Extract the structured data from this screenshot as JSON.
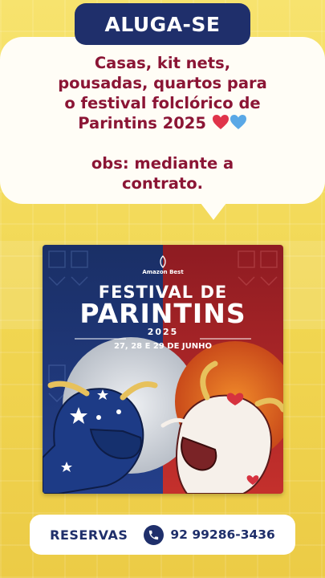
{
  "header": {
    "title": "ALUGA-SE"
  },
  "notice": {
    "line1": "Casas, kit nets,",
    "line2": "pousadas, quartos para",
    "line3": "o festival folclórico de",
    "line4": "Parintins 2025",
    "line5": "obs: mediante a",
    "line6": "contrato."
  },
  "poster": {
    "brand": "Amazon Best",
    "title_line1": "FESTIVAL DE",
    "title_line2": "PARINTINS",
    "year": "2025",
    "dates": "27, 28 E 29 DE JUNHO"
  },
  "footer": {
    "reservas_label": "RESERVAS",
    "phone": "92 99286-3436"
  },
  "icons": [
    "red-heart-icon",
    "blue-heart-icon",
    "phone-icon"
  ],
  "colors": {
    "navy": "#1f2f6b",
    "crimson": "#8b1535",
    "yellow": "#f2d85a",
    "poster_blue": "#1c3a7a",
    "poster_red": "#c22a2a"
  }
}
